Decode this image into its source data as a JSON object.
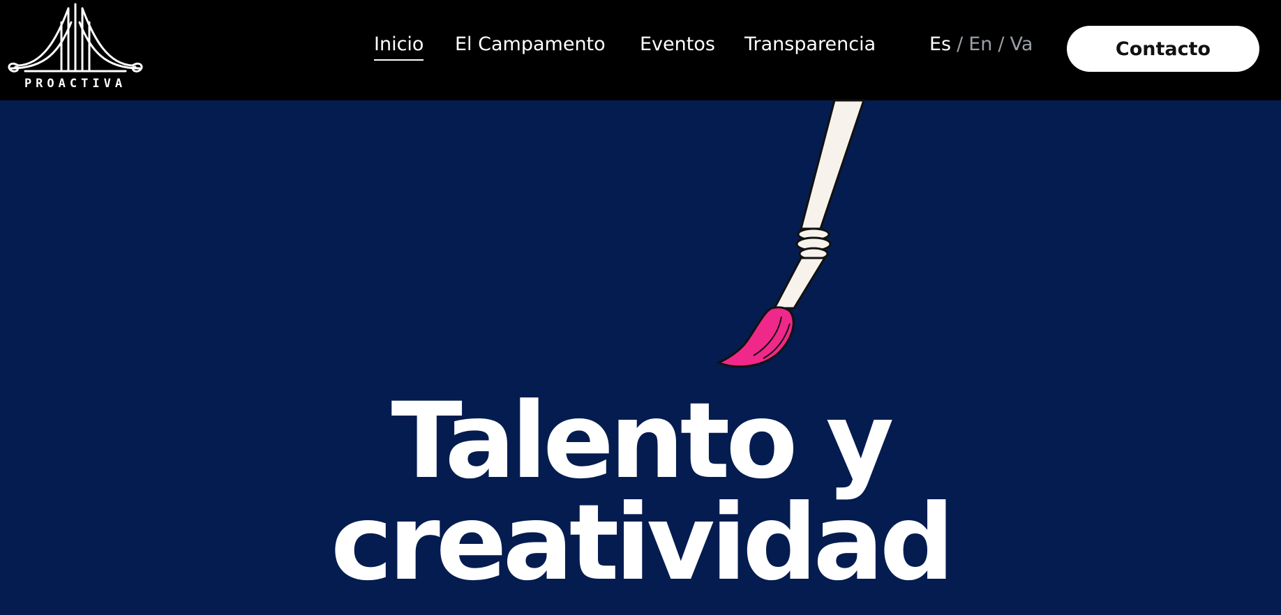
{
  "brand": {
    "logo_text": "PROACTIVA"
  },
  "nav": {
    "items": [
      {
        "label": "Inicio",
        "active": true
      },
      {
        "label": "El Campamento",
        "active": false
      },
      {
        "label": "Eventos",
        "active": false
      },
      {
        "label": "Transparencia",
        "active": false
      }
    ]
  },
  "language": {
    "options": [
      "Es",
      "En",
      "Va"
    ],
    "separator": "/",
    "selected": "Es"
  },
  "contact_button": {
    "label": "Contacto"
  },
  "hero": {
    "headline_line1": "Talento y",
    "headline_line2": "creatividad",
    "illustration": "paintbrush-icon"
  },
  "colors": {
    "navbar_bg": "#000000",
    "hero_bg": "#041c4f",
    "brush_tip": "#f0288a",
    "brush_handle": "#f7f3ec",
    "text": "#ffffff",
    "lang_inactive": "#9aa0a8"
  }
}
